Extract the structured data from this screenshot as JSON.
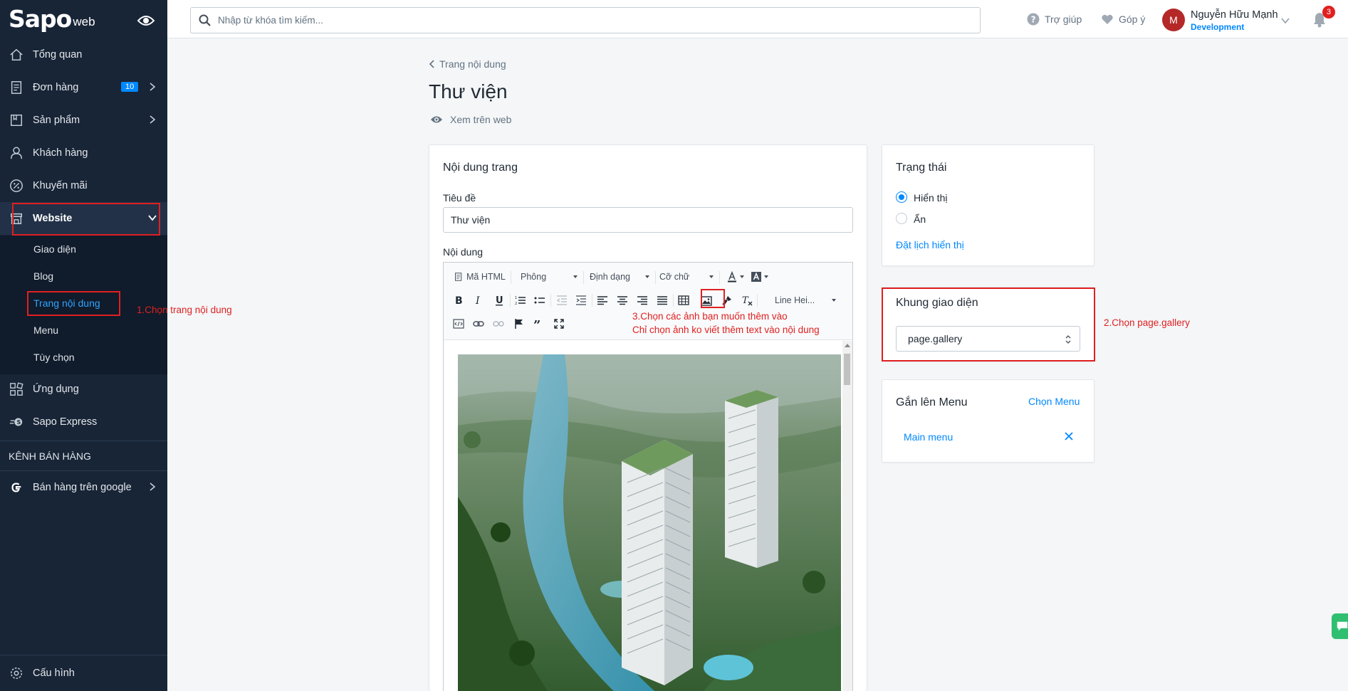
{
  "sidebar": {
    "logo_brand": "Sapo",
    "logo_sub": "web",
    "items": [
      {
        "label": "Tổng quan"
      },
      {
        "label": "Đơn hàng",
        "badge": "10"
      },
      {
        "label": "Sản phẩm"
      },
      {
        "label": "Khách hàng"
      },
      {
        "label": "Khuyến mãi"
      },
      {
        "label": "Website"
      }
    ],
    "website_sub": [
      "Giao diện",
      "Blog",
      "Trang nội dung",
      "Menu",
      "Tùy chọn"
    ],
    "apps": "Ứng dụng",
    "express": "Sapo Express",
    "channels_title": "KÊNH BÁN HÀNG",
    "google": "Bán hàng trên google",
    "settings": "Cấu hình"
  },
  "topbar": {
    "search_placeholder": "Nhập từ khóa tìm kiếm...",
    "help": "Trợ giúp",
    "feedback": "Góp ý",
    "avatar_initial": "M",
    "user_name": "Nguyễn Hữu Mạnh",
    "user_role": "Development",
    "notifications": "3"
  },
  "page": {
    "breadcrumb": "Trang nội dung",
    "title": "Thư viện",
    "view_on_web": "Xem trên web"
  },
  "content_card": {
    "title": "Nội dung trang",
    "title_label": "Tiêu đề",
    "title_value": "Thư viện",
    "content_label": "Nội dung",
    "toolbar": {
      "html": "Mã HTML",
      "font": "Phông",
      "format": "Định dạng",
      "size": "Cỡ chữ",
      "line_height": "Line Hei..."
    }
  },
  "status_card": {
    "title": "Trạng thái",
    "visible": "Hiển thị",
    "hidden": "Ẩn",
    "schedule": "Đặt lịch hiển thị"
  },
  "template_card": {
    "title": "Khung giao diện",
    "selected": "page.gallery"
  },
  "menu_card": {
    "title": "Gắn lên Menu",
    "choose": "Chọn Menu",
    "item": "Main menu"
  },
  "annotations": {
    "step1": "1.Chọn trang nội dung",
    "step2": "2.Chọn page.gallery",
    "step3_line1": "3.Chọn các ảnh bạn muốn thêm vào",
    "step3_line2": "Chỉ chọn ảnh ko viết thêm text vào nội dung"
  },
  "colors": {
    "sidebar_bg": "#182537",
    "accent": "#0088ff",
    "annotation_red": "#e02020"
  }
}
